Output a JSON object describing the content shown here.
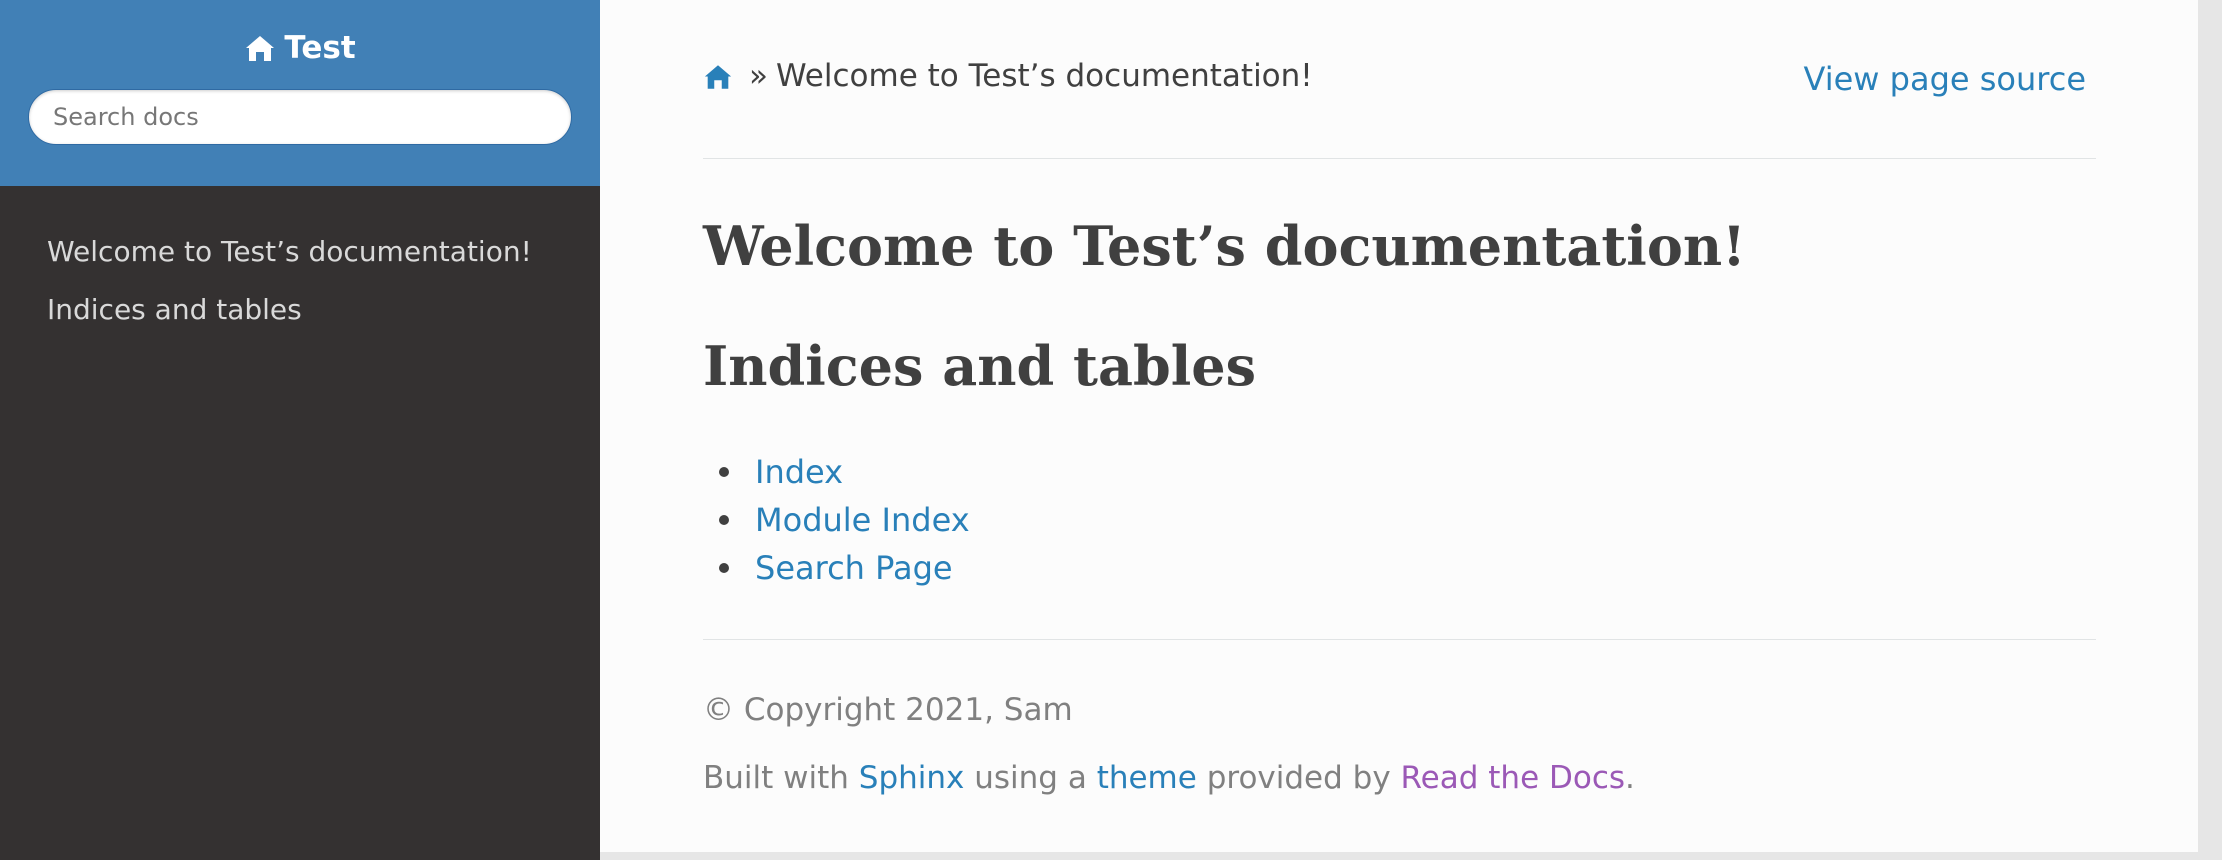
{
  "sidebar": {
    "project_name": "Test",
    "search_placeholder": "Search docs",
    "nav": [
      {
        "label": "Welcome to Test’s documentation!"
      },
      {
        "label": "Indices and tables"
      }
    ]
  },
  "breadcrumb": {
    "separator": "»",
    "current": "Welcome to Test’s documentation!"
  },
  "view_source_label": "View page source",
  "main": {
    "h1": "Welcome to Test’s documentation!",
    "h2": "Indices and tables",
    "links": [
      {
        "label": "Index"
      },
      {
        "label": "Module Index"
      },
      {
        "label": "Search Page"
      }
    ]
  },
  "footer": {
    "copyright": "© Copyright 2021, Sam",
    "built_prefix": "Built with ",
    "sphinx_label": "Sphinx",
    "using_text": " using a ",
    "theme_label": "theme",
    "provided_text": " provided by ",
    "rtd_label": "Read the Docs",
    "end_text": "."
  },
  "icons": {
    "home": "home-icon"
  },
  "colors": {
    "sidebar_top": "#4180b6",
    "sidebar_bg": "#343131",
    "link": "#2980b9",
    "visited_link": "#9b59b6"
  }
}
